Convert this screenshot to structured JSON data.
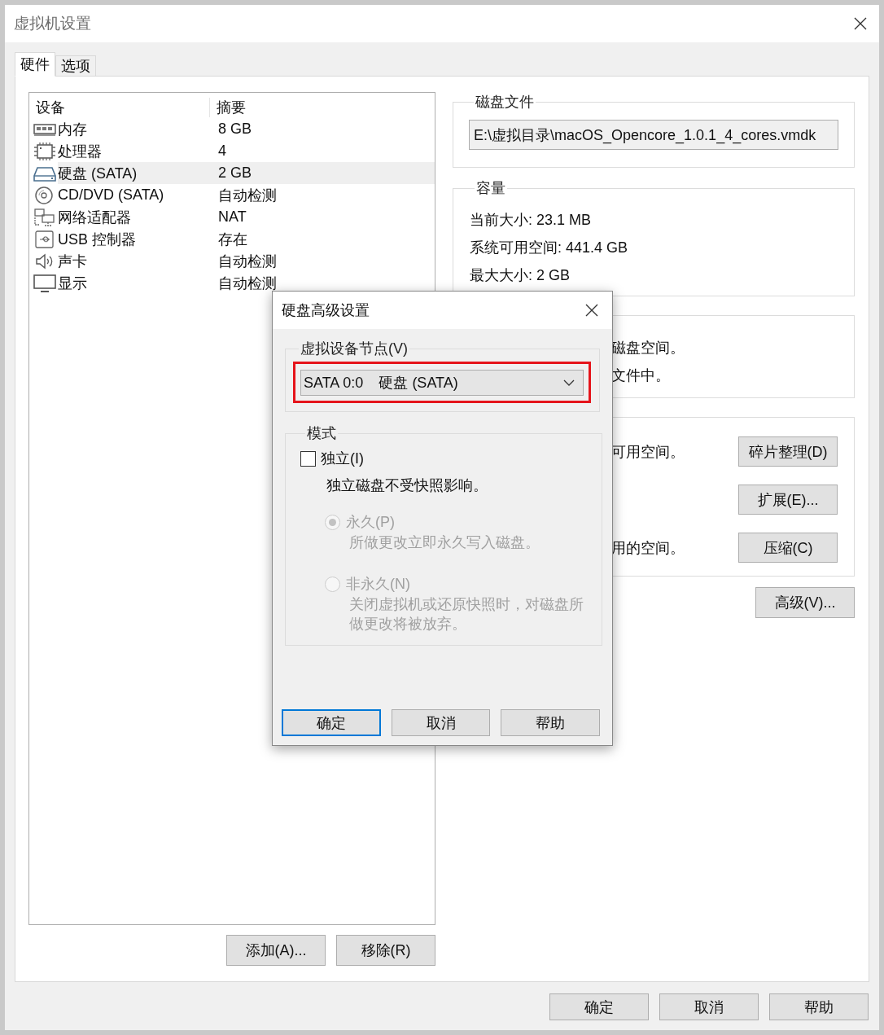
{
  "window": {
    "title": "虚拟机设置"
  },
  "tabs": [
    {
      "label": "硬件",
      "selected": true
    },
    {
      "label": "选项",
      "selected": false
    }
  ],
  "device_list": {
    "columns": [
      "设备",
      "摘要"
    ],
    "rows": [
      {
        "kind": "memory",
        "device": "内存",
        "summary": "8 GB",
        "selected": false
      },
      {
        "kind": "processor",
        "device": "处理器",
        "summary": "4",
        "selected": false
      },
      {
        "kind": "disk",
        "device": "硬盘 (SATA)",
        "summary": "2 GB",
        "selected": true
      },
      {
        "kind": "cd",
        "device": "CD/DVD (SATA)",
        "summary": "自动检测",
        "selected": false
      },
      {
        "kind": "network",
        "device": "网络适配器",
        "summary": "NAT",
        "selected": false
      },
      {
        "kind": "usb",
        "device": "USB 控制器",
        "summary": "存在",
        "selected": false
      },
      {
        "kind": "sound",
        "device": "声卡",
        "summary": "自动检测",
        "selected": false
      },
      {
        "kind": "display",
        "device": "显示",
        "summary": "自动检测",
        "selected": false
      }
    ]
  },
  "list_buttons": [
    "添加(A)...",
    "移除(R)"
  ],
  "disk_file": {
    "title": "磁盘文件",
    "value": "E:\\虚拟目录\\macOS_Opencore_1.0.1_4_cores.vmdk"
  },
  "capacity": {
    "title": "容量",
    "lines": [
      "当前大小: 23.1 MB",
      "系统可用空间: 441.4 GB",
      "最大大小: 2 GB"
    ]
  },
  "info_group": {
    "lines": [
      "磁盘空间。",
      "文件中。"
    ]
  },
  "utilities_group": {
    "rows": [
      {
        "text": "可用空间。",
        "button": "碎片整理(D)"
      },
      {
        "button": "扩展(E)..."
      },
      {
        "text": "用的空间。",
        "button": "压缩(C)"
      }
    ]
  },
  "advanced_button": "高级(V)...",
  "footer_buttons": [
    "确定",
    "取消",
    "帮助"
  ],
  "dialog": {
    "title": "硬盘高级设置",
    "node_group": {
      "title": "虚拟设备节点(V)",
      "node": "SATA 0:0",
      "device": "硬盘 (SATA)",
      "highlighted": true
    },
    "mode_group": {
      "title": "模式",
      "independent": {
        "label": "独立(I)",
        "checked": false
      },
      "description": "独立磁盘不受快照影响。",
      "options": [
        {
          "label": "永久(P)",
          "description": "所做更改立即永久写入磁盘。",
          "selected": true,
          "disabled": true
        },
        {
          "label": "非永久(N)",
          "description": "关闭虚拟机或还原快照时，对磁盘所做更改将被放弃。",
          "selected": false,
          "disabled": true
        }
      ]
    },
    "buttons": [
      {
        "label": "确定",
        "default": true
      },
      {
        "label": "取消",
        "default": false
      },
      {
        "label": "帮助",
        "default": false
      }
    ]
  }
}
